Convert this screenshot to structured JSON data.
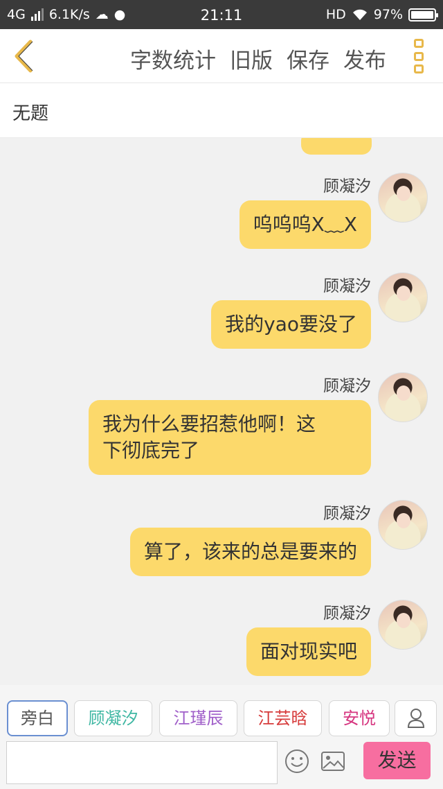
{
  "status_bar": {
    "network": "4G",
    "speed": "6.1K/s",
    "time": "21:11",
    "hd": "HD",
    "battery": "97%"
  },
  "toolbar": {
    "word_count": "字数统计",
    "old_version": "旧版",
    "save": "保存",
    "publish": "发布"
  },
  "title": "无题",
  "messages": [
    {
      "name": "顾凝汐",
      "lines": [
        "呜呜呜X﹏X"
      ]
    },
    {
      "name": "顾凝汐",
      "lines": [
        "我的yao要没了"
      ]
    },
    {
      "name": "顾凝汐",
      "lines": [
        "我为什么要招惹他啊！这",
        "下彻底完了"
      ]
    },
    {
      "name": "顾凝汐",
      "lines": [
        "算了，该来的总是要来的"
      ]
    },
    {
      "name": "顾凝汐",
      "lines": [
        "面对现实吧"
      ]
    }
  ],
  "roles": [
    {
      "label": "旁白",
      "color": "#555555"
    },
    {
      "label": "顾凝汐",
      "color": "#3fb7a3"
    },
    {
      "label": "江瑾辰",
      "color": "#a05fc9"
    },
    {
      "label": "江芸晗",
      "color": "#d63a3a"
    },
    {
      "label": "安悦",
      "color": "#d6357f"
    }
  ],
  "input": {
    "placeholder": ""
  },
  "send_label": "发送",
  "colors": {
    "bubble": "#fcd96b",
    "send": "#f76ea0",
    "accent": "#e8b84a"
  },
  "icons": [
    "back-chevron-icon",
    "more-icon",
    "person-icon",
    "emoji-icon",
    "image-icon"
  ]
}
